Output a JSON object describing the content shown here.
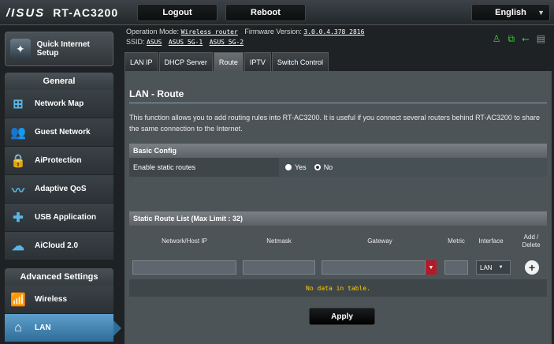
{
  "header": {
    "brand": "/ISUS",
    "model": "RT-AC3200",
    "logout_label": "Logout",
    "reboot_label": "Reboot",
    "language": "English"
  },
  "info": {
    "op_mode_label": "Operation Mode:",
    "op_mode_value": "Wireless router",
    "fw_label": "Firmware Version:",
    "fw_value": "3.0.0.4.378_2816",
    "ssid_label": "SSID:",
    "ssids": [
      "ASUS",
      "ASUS_5G-1",
      "ASUS_5G-2"
    ]
  },
  "sidebar": {
    "quick_setup": "Quick Internet Setup",
    "general_title": "General",
    "general_items": [
      {
        "label": "Network Map",
        "icon": "network-map-icon"
      },
      {
        "label": "Guest Network",
        "icon": "guest-network-icon"
      },
      {
        "label": "AiProtection",
        "icon": "lock-icon"
      },
      {
        "label": "Adaptive QoS",
        "icon": "qos-icon"
      },
      {
        "label": "USB Application",
        "icon": "puzzle-icon"
      },
      {
        "label": "AiCloud 2.0",
        "icon": "cloud-icon"
      }
    ],
    "advanced_title": "Advanced Settings",
    "advanced_items": [
      {
        "label": "Wireless",
        "icon": "wifi-icon"
      },
      {
        "label": "LAN",
        "icon": "home-icon",
        "active": true
      }
    ]
  },
  "tabs": [
    {
      "label": "LAN IP"
    },
    {
      "label": "DHCP Server"
    },
    {
      "label": "Route",
      "active": true
    },
    {
      "label": "IPTV"
    },
    {
      "label": "Switch Control"
    }
  ],
  "main": {
    "title": "LAN - Route",
    "description": "This function allows you to add routing rules into RT-AC3200. It is useful if you connect several routers behind RT-AC3200 to share the same connection to the Internet.",
    "basic_config_title": "Basic Config",
    "enable_static_label": "Enable static routes",
    "yes_label": "Yes",
    "no_label": "No",
    "route_list_title": "Static Route List (Max Limit : 32)",
    "columns": [
      "Network/Host IP",
      "Netmask",
      "Gateway",
      "Metric",
      "Interface",
      "Add / Delete"
    ],
    "interface_value": "LAN",
    "no_data": "No data in table.",
    "apply_label": "Apply"
  }
}
